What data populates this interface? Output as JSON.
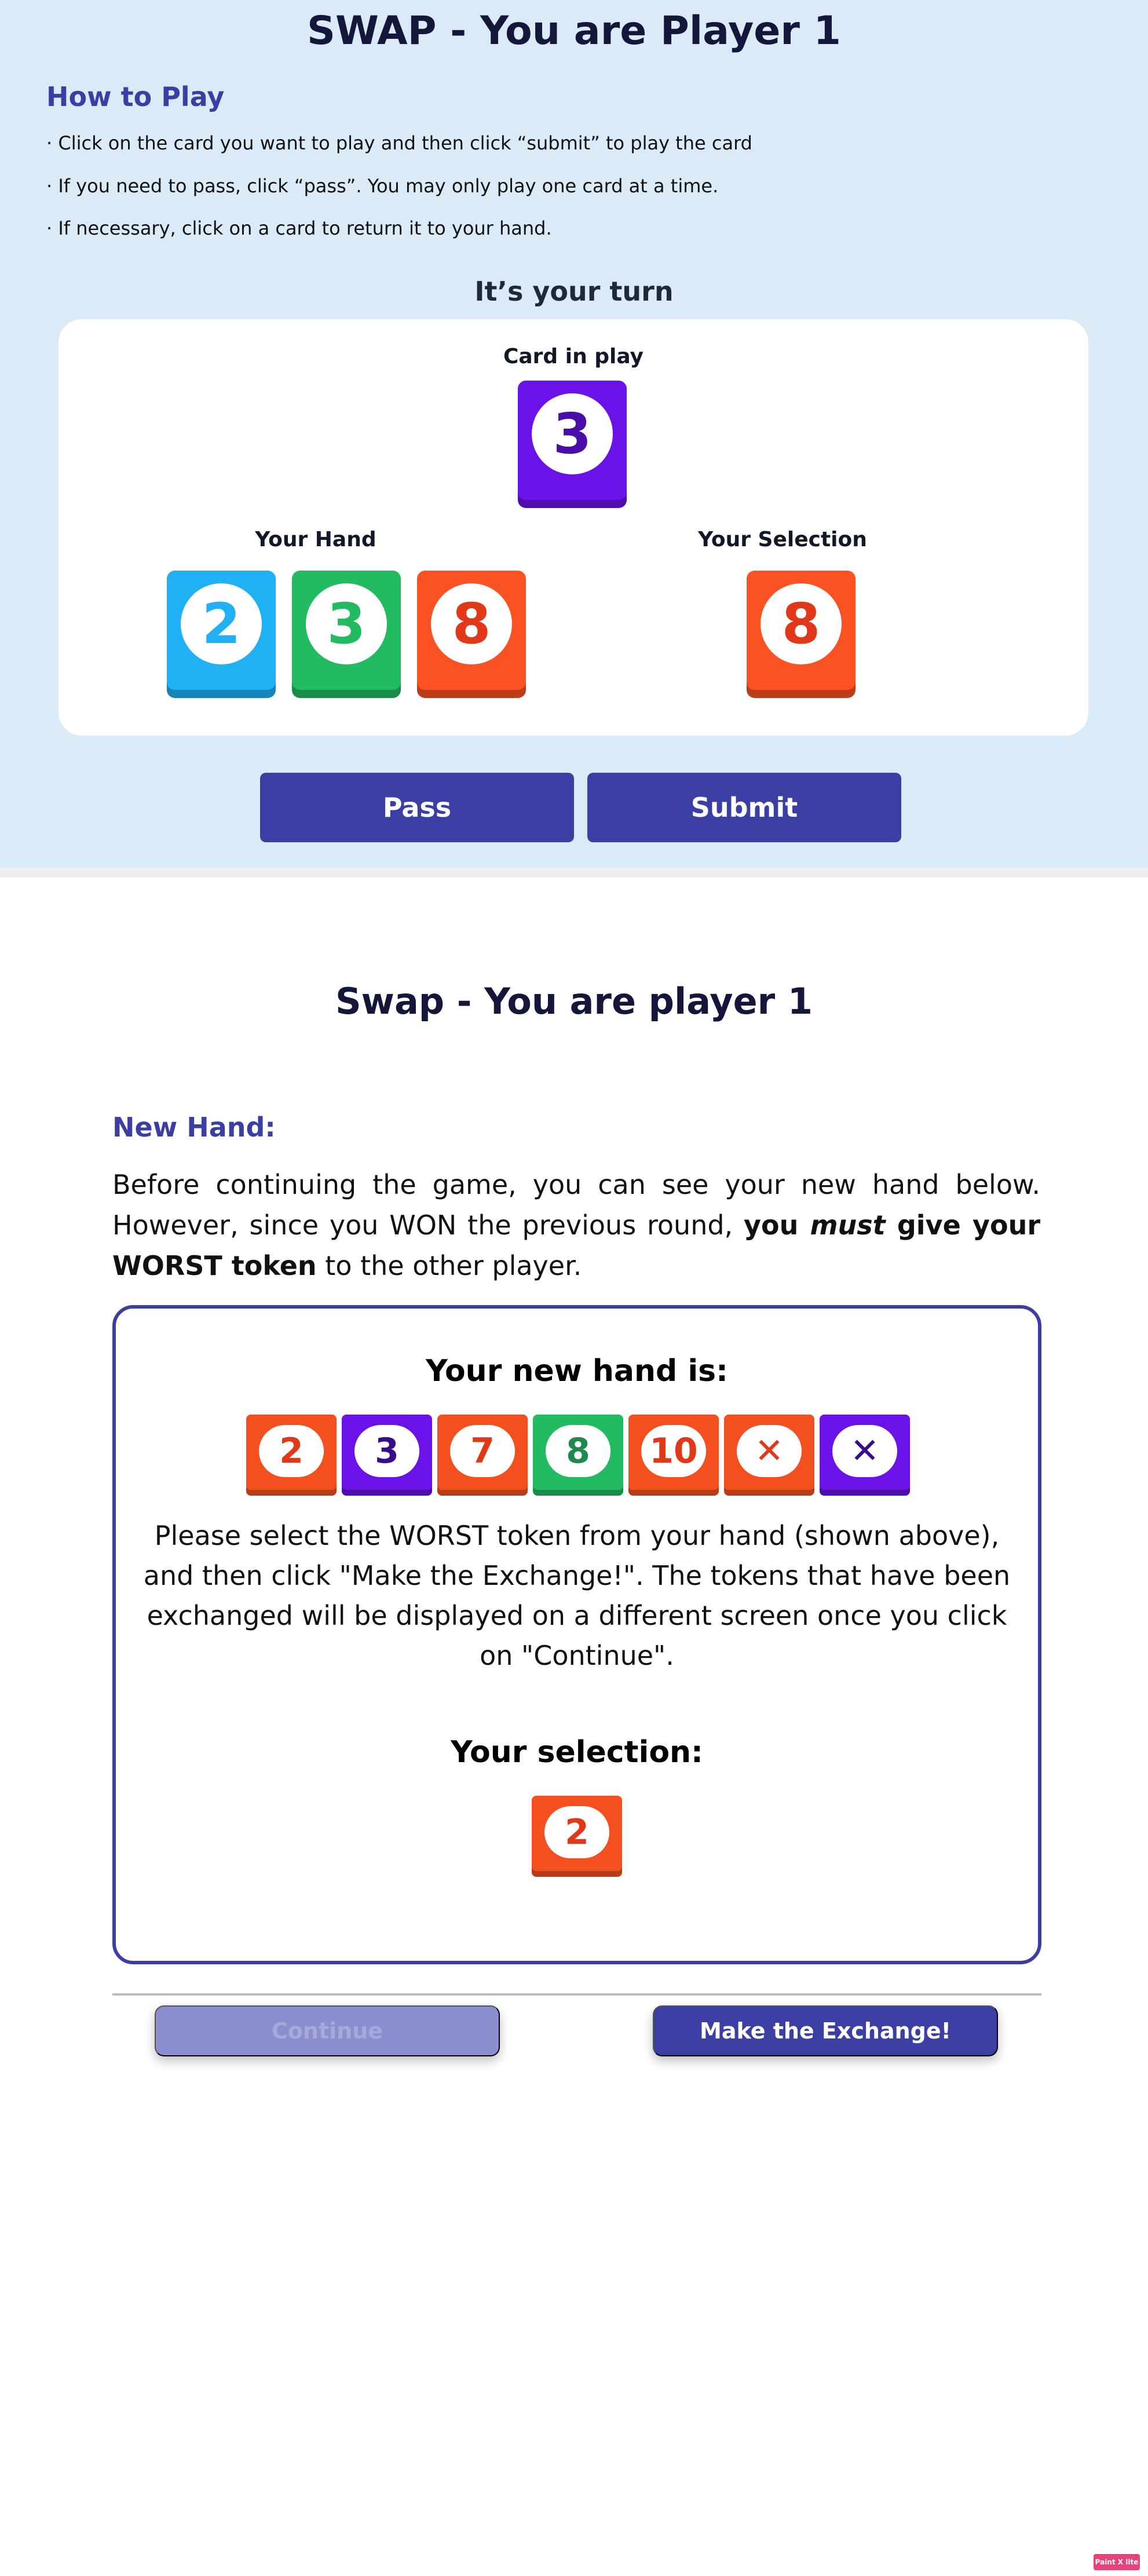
{
  "screen1": {
    "title": "SWAP - You are Player 1",
    "how_to_play": {
      "heading": "How to Play",
      "rules": [
        "· Click on the card you want to play and then click “submit” to play the card",
        "· If you need to pass, click “pass”. You may only play one card at a time.",
        "· If necessary, click on a card to return it to your hand."
      ]
    },
    "turn_status": "It’s your turn",
    "card_in_play": {
      "label": "Card in play",
      "card": {
        "value": "3",
        "color": "#6a12e8",
        "text_color": "#4a0ea8"
      }
    },
    "your_hand": {
      "label": "Your Hand",
      "cards": [
        {
          "value": "2",
          "color": "#1fb1f4",
          "text_color": "#1fb1f4"
        },
        {
          "value": "3",
          "color": "#23bb62",
          "text_color": "#23bb62"
        },
        {
          "value": "8",
          "color": "#fa5223",
          "text_color": "#e2381a"
        }
      ]
    },
    "your_selection": {
      "label": "Your Selection",
      "card": {
        "value": "8",
        "color": "#fa5223",
        "text_color": "#e2381a"
      }
    },
    "buttons": {
      "pass": "Pass",
      "submit": "Submit"
    }
  },
  "screen2": {
    "title": "Swap - You are player 1",
    "new_hand_heading": "New Hand:",
    "intro": {
      "text_before": "Before continuing the game, you can see your new hand below. However, since you WON the previous round, ",
      "bold_you": "you ",
      "italic_must": "must",
      "bold_rest": " give your WORST token",
      "text_after": " to the other player."
    },
    "new_hand_label": "Your new hand is:",
    "tokens": [
      {
        "value": "2",
        "color": "#f4501f",
        "text_color": "#e2381a"
      },
      {
        "value": "3",
        "color": "#6a12e8",
        "text_color": "#3a0b8a"
      },
      {
        "value": "7",
        "color": "#f4501f",
        "text_color": "#e2381a"
      },
      {
        "value": "8",
        "color": "#23bb62",
        "text_color": "#1f8a4c"
      },
      {
        "value": "10",
        "color": "#f4501f",
        "text_color": "#e2381a"
      },
      {
        "value": "✕",
        "color": "#f4501f",
        "text_color": "#e2381a"
      },
      {
        "value": "✕",
        "color": "#6a12e8",
        "text_color": "#3a0b8a"
      }
    ],
    "instructions": "Please select the WORST token from your hand (shown above), and then click \"Make the Exchange!\". The tokens that have been exchanged will be displayed on a different screen once you click on \"Continue\".",
    "selection_label": "Your selection:",
    "selected_token": {
      "value": "2",
      "color": "#f4501f",
      "text_color": "#e2381a"
    },
    "buttons": {
      "continue": "Continue",
      "exchange": "Make the Exchange!"
    }
  },
  "footer_badge": "Paint X lite",
  "colors": {
    "accent": "#3b3fa3",
    "page_bg": "#dbeaf7"
  }
}
